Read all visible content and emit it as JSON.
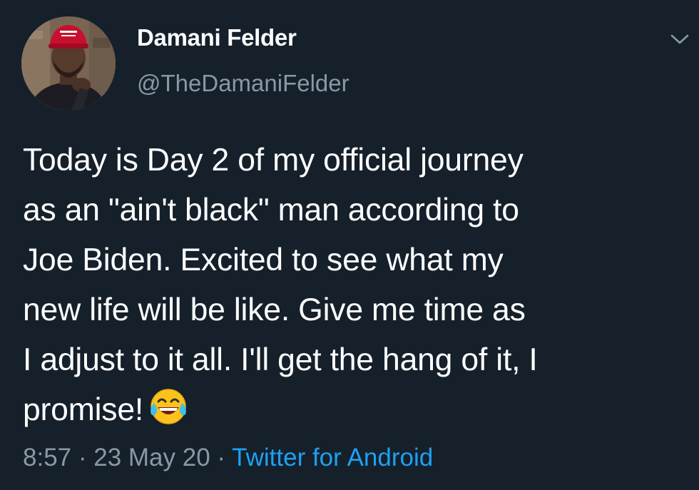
{
  "user": {
    "display_name": "Damani Felder",
    "handle": "@TheDamaniFelder"
  },
  "tweet": {
    "lines": [
      "Today is Day 2 of my official journey",
      "as an \"ain't black\" man according to",
      "Joe Biden. Excited to see what my",
      "new life will be like. Give me time as",
      "I adjust to it all. I'll get the hang of it, I",
      "promise!"
    ],
    "emoji": "face-with-tears-of-joy-icon"
  },
  "meta": {
    "time": "8:57",
    "separator": " · ",
    "date": "23 May 20",
    "source": "Twitter for Android"
  },
  "colors": {
    "background": "#15202b",
    "primary_text": "#ffffff",
    "secondary_text": "#8899a6",
    "link": "#1da1f2"
  },
  "icons": {
    "menu": "chevron-down-icon",
    "avatar": "profile-photo"
  }
}
